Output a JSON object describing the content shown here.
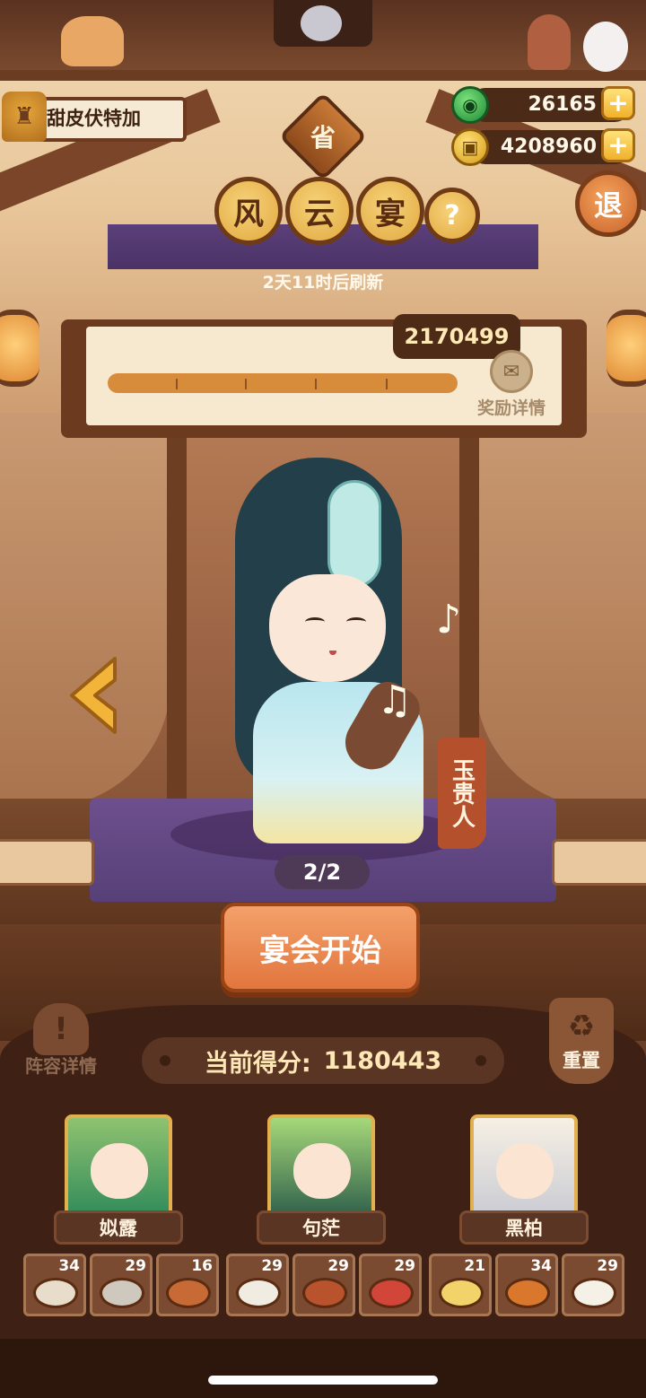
{
  "player": {
    "name": "甜皮伏特加",
    "avatar_icon": "player-avatar-icon"
  },
  "resources": {
    "jade": {
      "value": "26165",
      "icon": "jade-icon"
    },
    "coins": {
      "value": "4208960",
      "icon": "coin-icon"
    },
    "plus_label": "+"
  },
  "exit_label": "退",
  "province_label": "省",
  "event": {
    "title_chars": [
      "风",
      "云",
      "宴"
    ],
    "help_label": "?",
    "refresh_text": "2天11时后刷新"
  },
  "progress": {
    "total": "2170499",
    "fill_fraction": 1.0,
    "reward_label": "奖励详情",
    "reward_icon": "gift-icon"
  },
  "character": {
    "name": "玉贵人",
    "page": "2/2"
  },
  "start_label": "宴会开始",
  "lineup_label": "阵容详情",
  "lineup_icon": "exclamation-icon",
  "score": {
    "label": "当前得分:",
    "value": "1180443"
  },
  "reset_label": "重置",
  "reset_icon": "recycle-icon",
  "heroes": [
    {
      "name": "姒露"
    },
    {
      "name": "句茫"
    },
    {
      "name": "黑柏"
    }
  ],
  "dishes": [
    {
      "count": "34",
      "color": "#e8dccb"
    },
    {
      "count": "29",
      "color": "#cfc8bf"
    },
    {
      "count": "16",
      "color": "#c86a36"
    },
    {
      "count": "29",
      "color": "#f1ece2"
    },
    {
      "count": "29",
      "color": "#b8532e"
    },
    {
      "count": "29",
      "color": "#d2463a"
    },
    {
      "count": "21",
      "color": "#f1d36a"
    },
    {
      "count": "34",
      "color": "#d9782c"
    },
    {
      "count": "29",
      "color": "#f5f1e6"
    }
  ],
  "colors": {
    "accent_orange": "#e1763e",
    "wood_dark": "#4e2b17",
    "gold": "#e3b04f",
    "stage_purple": "#574078"
  }
}
